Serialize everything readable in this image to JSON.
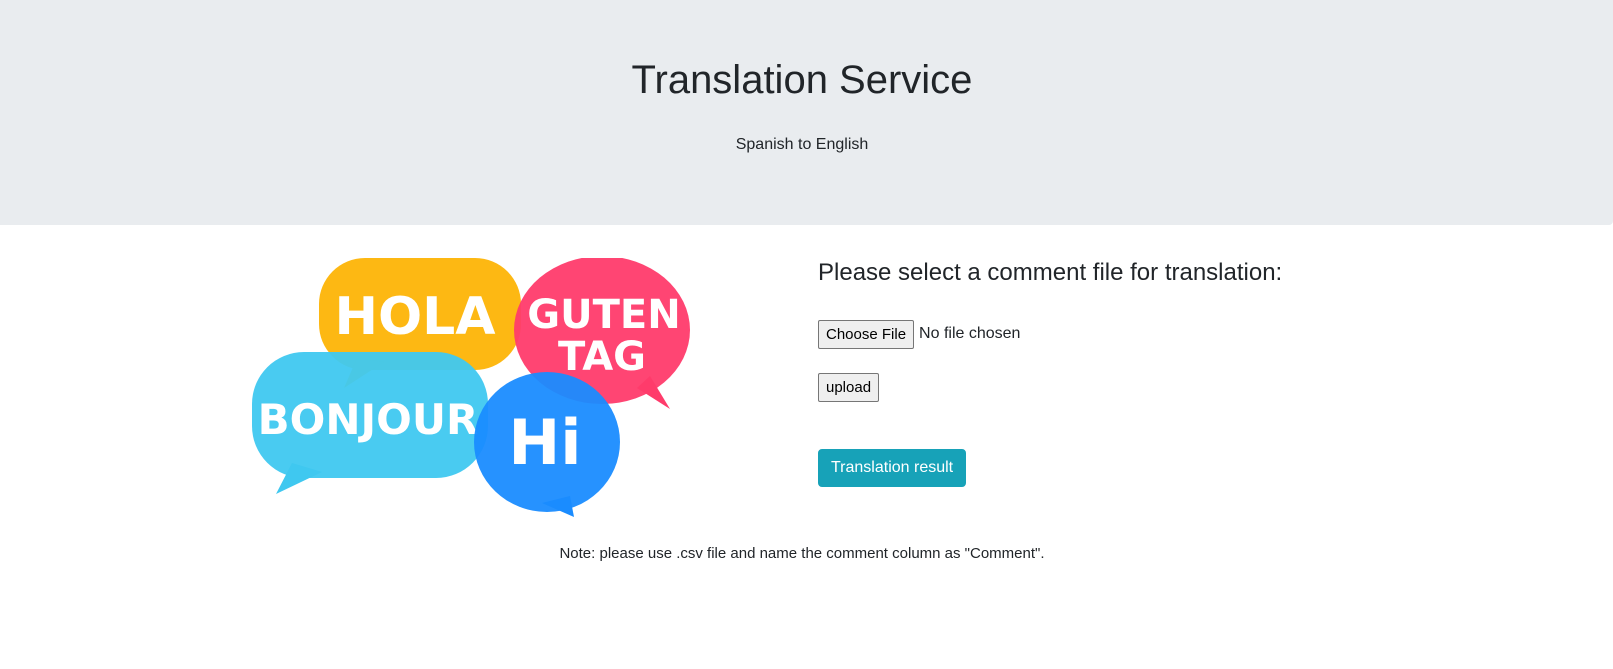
{
  "header": {
    "title": "Translation Service",
    "subtitle": "Spanish to English"
  },
  "illustration": {
    "bubbles": [
      {
        "text": "HOLA",
        "color": "#FDB813"
      },
      {
        "text": "GUTEN",
        "color": "#FF3B6B"
      },
      {
        "text": "TAG",
        "color": "#FF3B6B"
      },
      {
        "text": "BONJOUR",
        "color": "#3FC8F0"
      },
      {
        "text": "Hi",
        "color": "#1A8CFF"
      }
    ]
  },
  "form": {
    "heading": "Please select a comment file for translation:",
    "choose_file_label": "Choose File",
    "file_status": "No file chosen",
    "upload_label": "upload",
    "result_label": "Translation result"
  },
  "note": "Note: please use .csv file and name the comment column as \"Comment\".",
  "colors": {
    "jumbotron_bg": "#e9ecef",
    "accent_button": "#17a2b8"
  }
}
